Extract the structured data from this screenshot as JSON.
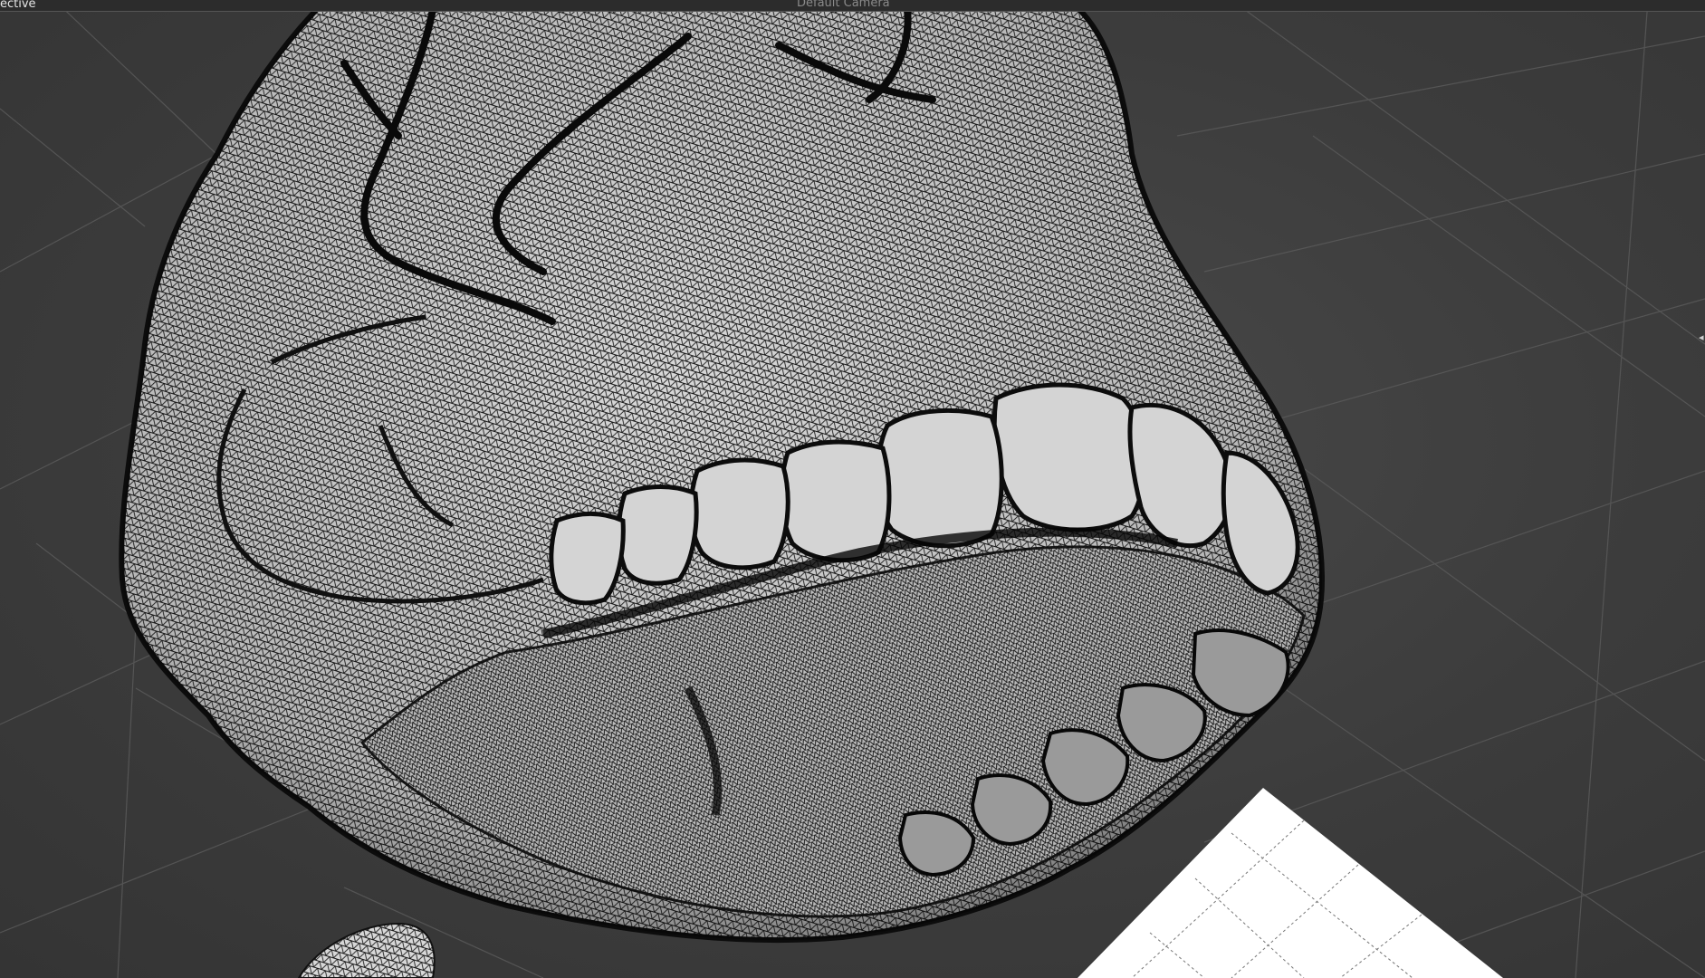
{
  "viewport": {
    "view_mode_label": "ective",
    "camera_label": "Default Camera",
    "background_color": "#3e3e3e",
    "grid_color": "#5a5a5a",
    "mesh_fill_color": "#cfcfcf",
    "mesh_wire_color": "#111111",
    "pivot_plane_color": "#ffffff"
  },
  "icons": {
    "handle": "pan-handle-icon"
  }
}
